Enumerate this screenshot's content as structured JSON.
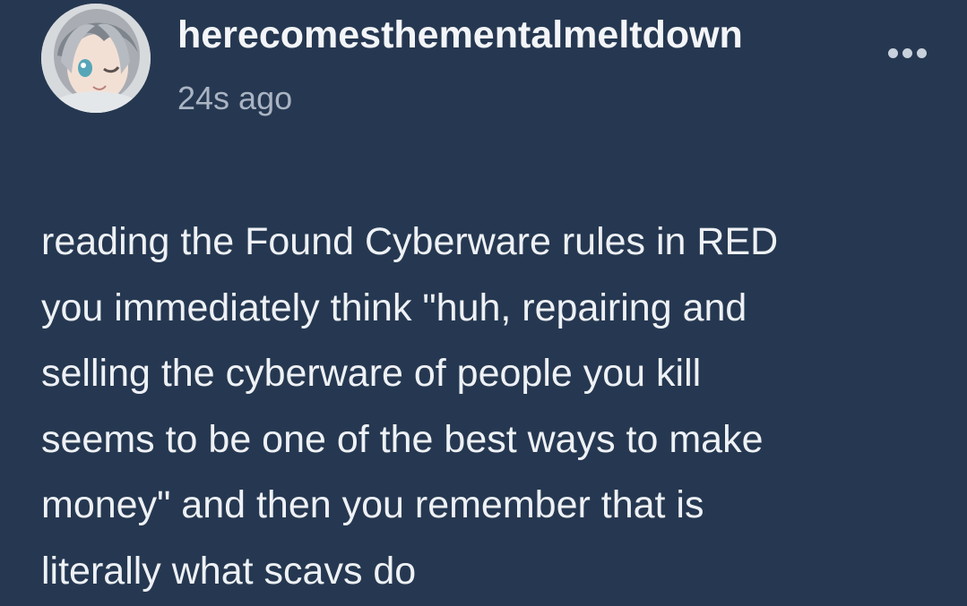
{
  "post": {
    "author": {
      "username": "herecomesthementalmeltdown",
      "avatar_icon": "anime-avatar"
    },
    "timestamp": "24s ago",
    "menu_icon": "more-horizontal-icon",
    "body_lines": [
      "reading the Found Cyberware rules in RED",
      "you immediately think \"huh, repairing and",
      "selling the cyberware of people you kill",
      "seems to be one of the best ways to make",
      "money\" and then you remember that is",
      "literally what scavs do"
    ]
  },
  "colors": {
    "background": "#263851",
    "text": "#eef1f5",
    "muted_text": "#aab4c3"
  }
}
